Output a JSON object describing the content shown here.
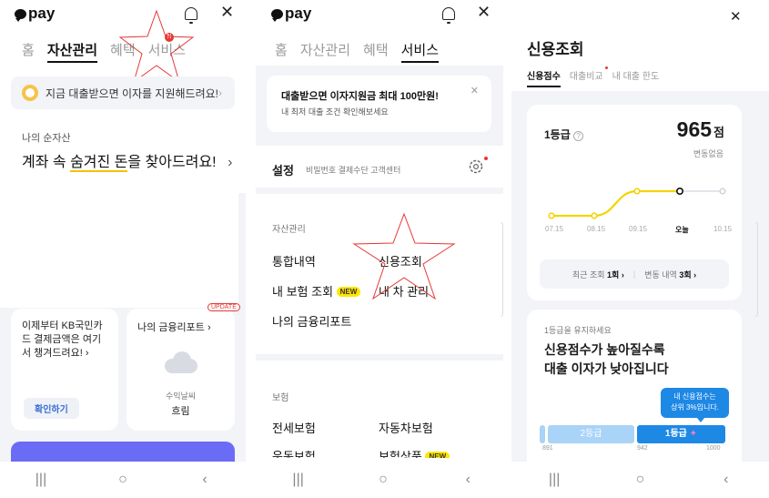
{
  "brand": "pay",
  "screen1": {
    "tabs": [
      "홈",
      "자산관리",
      "혜택",
      "서비스"
    ],
    "notification_badge": "N",
    "banner_text": "지금 대출받으면 이자를 지원해드려요!",
    "section_label": "나의 순자산",
    "headline_before": "계좌 속 ",
    "headline_highlight": "숨겨진 돈",
    "headline_after": "을 찾아드려요!",
    "card_left_text": "이제부터 KB국민카드 결제금액은 여기서 챙겨드려요! ›",
    "card_left_button": "확인하기",
    "card_right_badge": "UPDATE",
    "card_right_title": "나의 금융리포트 ›",
    "card_right_sub": "수익날씨",
    "card_right_value": "흐림"
  },
  "screen2": {
    "tabs": [
      "홈",
      "자산관리",
      "혜택",
      "서비스"
    ],
    "notice_title": "대출받으면 이자지원금 최대 100만원!",
    "notice_sub": "내 최저 대출 조건 확인해보세요",
    "settings_label": "설정",
    "settings_sub": "비밀번호 결제수단 고객센터",
    "asset_section": "자산관리",
    "asset_items": [
      "통합내역",
      "신용조회",
      "내 보험 조회",
      "내 차 관리",
      "나의 금융리포트"
    ],
    "new_badge": "NEW",
    "insurance_section": "보험",
    "insurance_items": [
      "전세보험",
      "자동차보험",
      "운동보험",
      "보험상품"
    ]
  },
  "screen3": {
    "title": "신용조회",
    "tabs": [
      "신용점수",
      "대출비교",
      "내 대출 한도"
    ],
    "grade": "1등급",
    "score": "965",
    "score_unit": "점",
    "change": "변동없음",
    "chart_labels": [
      "07.15",
      "08.15",
      "09.15",
      "오늘",
      "10.15"
    ],
    "recent_label": "최근 조회",
    "recent_value": "1회 ›",
    "change_label": "변동 내역",
    "change_value": "3회 ›",
    "promo_sub": "1등급을 유지하세요",
    "promo_line1": "신용점수가 높아질수록",
    "promo_line2": "대출 이자가 낮아집니다",
    "tooltip_line1": "내 신용점수는",
    "tooltip_line2": "상위 3%입니다.",
    "grade_bar": [
      "2등급",
      "1등급"
    ],
    "grade_ticks": [
      "891",
      "942",
      "1000"
    ]
  },
  "chart_data": {
    "type": "line",
    "categories": [
      "07.15",
      "08.15",
      "09.15",
      "오늘",
      "10.15"
    ],
    "series": [
      {
        "values": [
          0,
          0,
          1,
          1,
          null
        ]
      }
    ]
  },
  "colors": {
    "accent_yellow": "#f5d300",
    "blue": "#1e88e5",
    "light_blue": "#a9d3f7",
    "purple": "#6b6cf6",
    "red": "#e53935",
    "bg_gray": "#f2f4f7"
  },
  "icons": [
    "bell-icon",
    "close-icon",
    "gear-icon",
    "help-icon",
    "cloud-icon",
    "smile-icon"
  ]
}
